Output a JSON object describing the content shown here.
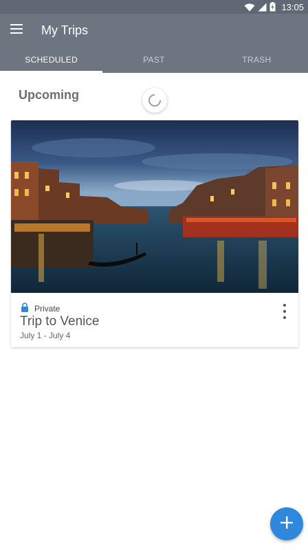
{
  "status_bar": {
    "time": "13:05",
    "icons": [
      "wifi-icon",
      "signal-icon",
      "battery-charging-icon"
    ]
  },
  "app_bar": {
    "title": "My Trips",
    "menu_icon": "hamburger-menu-icon"
  },
  "tabs": [
    {
      "label": "SCHEDULED",
      "active": true
    },
    {
      "label": "PAST",
      "active": false
    },
    {
      "label": "TRASH",
      "active": false
    }
  ],
  "main": {
    "section_title": "Upcoming",
    "loading": true,
    "trip_card": {
      "image_description_icon": "venice-grand-canal-photo",
      "privacy_label": "Private",
      "privacy_icon": "lock-icon",
      "title": "Trip to Venice",
      "dates": "July 1 - July 4",
      "more_icon": "more-vert-icon"
    }
  },
  "fab": {
    "icon": "plus-icon"
  },
  "colors": {
    "app_bar": "#6d7580",
    "status_bar": "#5f6873",
    "accent": "#2f88dc",
    "lock": "#2f88dc"
  }
}
